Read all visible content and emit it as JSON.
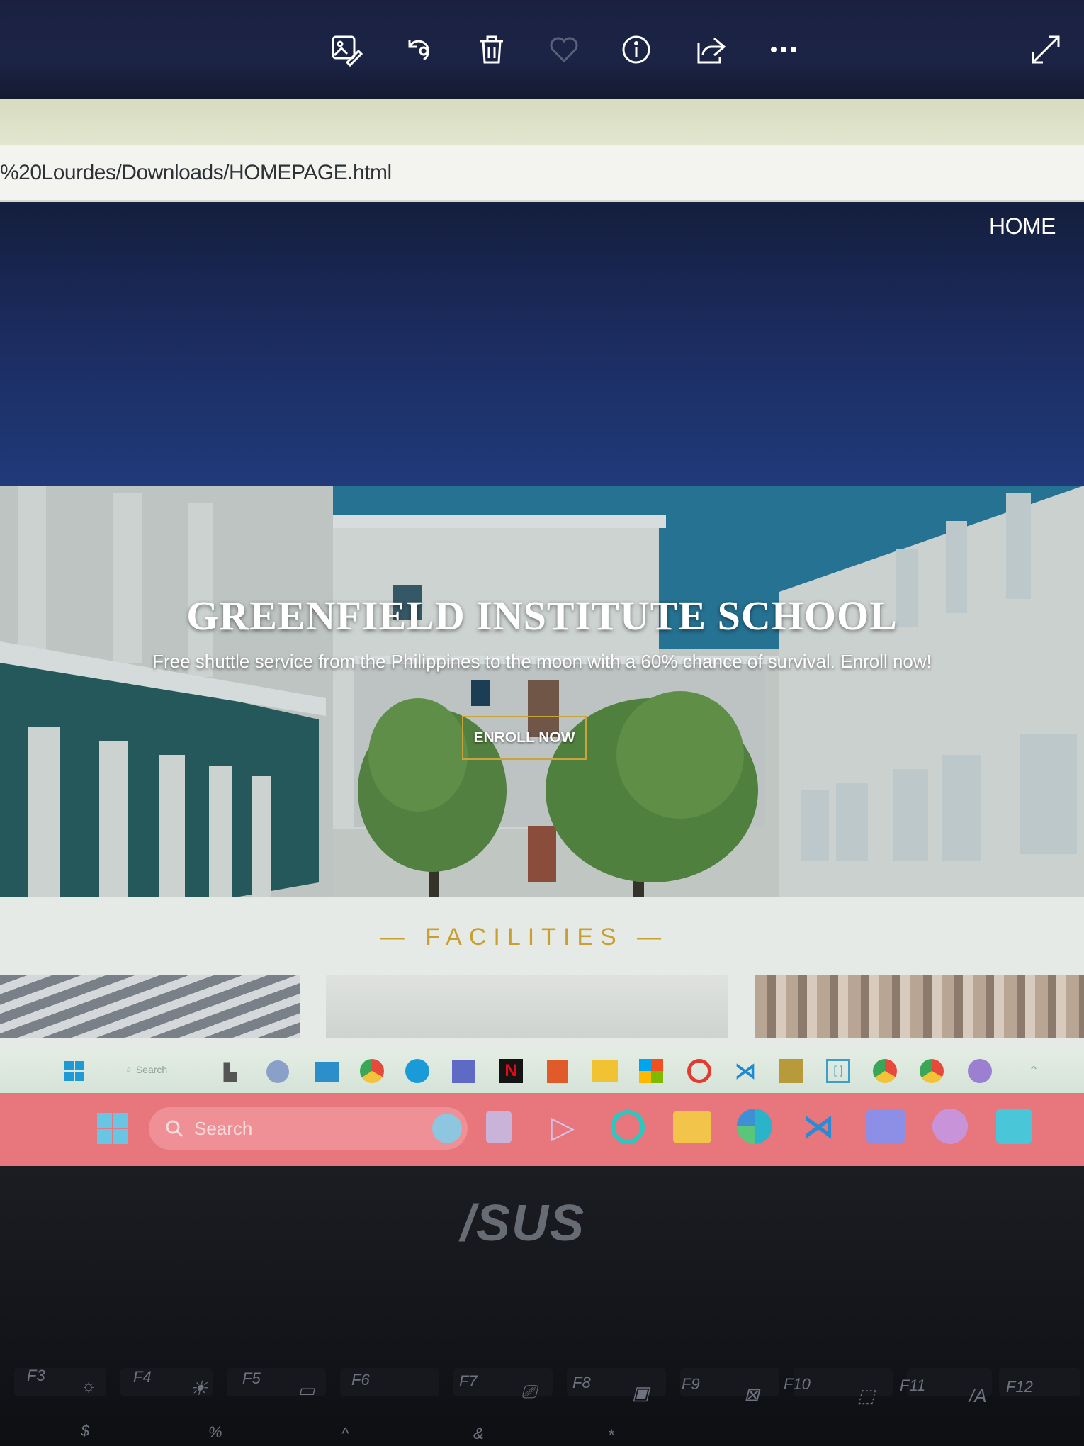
{
  "viewer_toolbar": {
    "buttons": [
      "edit-icon",
      "rotate-icon",
      "delete-icon",
      "favorite-icon",
      "info-icon",
      "share-icon",
      "more-icon"
    ],
    "expand": "expand-icon"
  },
  "browser": {
    "address": "%20Lourdes/Downloads/HOMEPAGE.html"
  },
  "site": {
    "nav_home": "HOME",
    "hero": {
      "title": "GREENFIELD  INSTITUTE  SCHOOL",
      "subtitle": "Free shuttle service from the Philippines to the moon with a 60% chance of survival. Enroll now!",
      "cta": "ENROLL NOW"
    },
    "facilities_heading": "— FACILITIES —"
  },
  "taskbar_old": {
    "search": "Search"
  },
  "taskbar_new": {
    "search": "Search"
  },
  "laptop": {
    "brand": "/SUS",
    "fkeys": [
      "F3",
      "F4",
      "F5",
      "F6",
      "F7",
      "F8",
      "F9",
      "F10",
      "F11",
      "F12"
    ],
    "number_row": [
      "$",
      "%",
      "^",
      "&",
      "*"
    ]
  },
  "colors": {
    "accent_gold": "#c9a43a",
    "navbar": "#1b2b5e",
    "taskbar": "#e7767d"
  }
}
